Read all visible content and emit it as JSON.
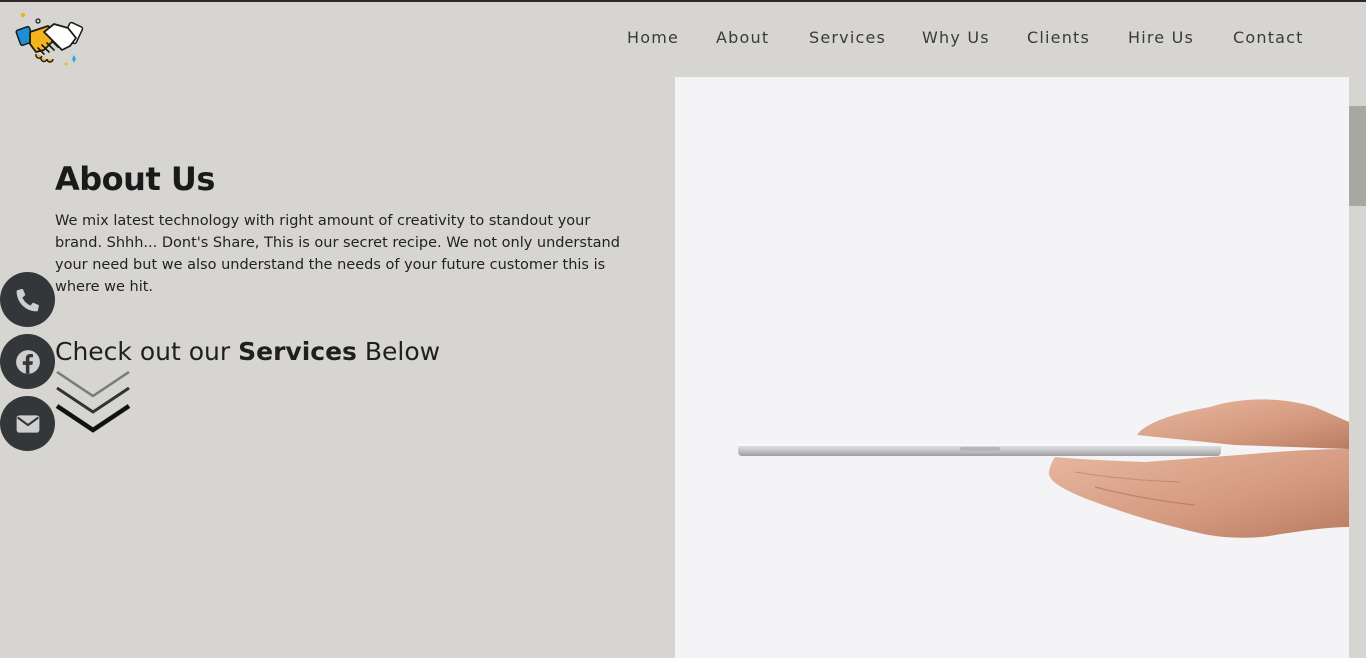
{
  "brand": {
    "logo_icon": "handshake-icon"
  },
  "nav": {
    "items": [
      {
        "label": "Home"
      },
      {
        "label": "About"
      },
      {
        "label": "Services"
      },
      {
        "label": "Why Us"
      },
      {
        "label": "Clients"
      },
      {
        "label": "Hire Us"
      },
      {
        "label": "Contact"
      }
    ]
  },
  "about": {
    "title": "About Us",
    "text": "We mix latest technology with right amount of creativity to standout your brand. Shhh... Dont's Share, This is our secret recipe. We not only understand your need but we also understand the needs of your future customer this is where we hit."
  },
  "services_cta": {
    "prefix": "Check out our ",
    "bold": "Services",
    "suffix": " Below",
    "icon": "double-chevron-down-icon"
  },
  "social": [
    {
      "icon": "phone-icon"
    },
    {
      "icon": "facebook-icon"
    },
    {
      "icon": "envelope-icon"
    }
  ],
  "hero": {
    "image": "hand-holding-tablet"
  },
  "colors": {
    "background": "#d6d5d1",
    "hero_background": "#f4f4f6",
    "social_button": "#333739",
    "nav_text": "#3a3a3a"
  }
}
